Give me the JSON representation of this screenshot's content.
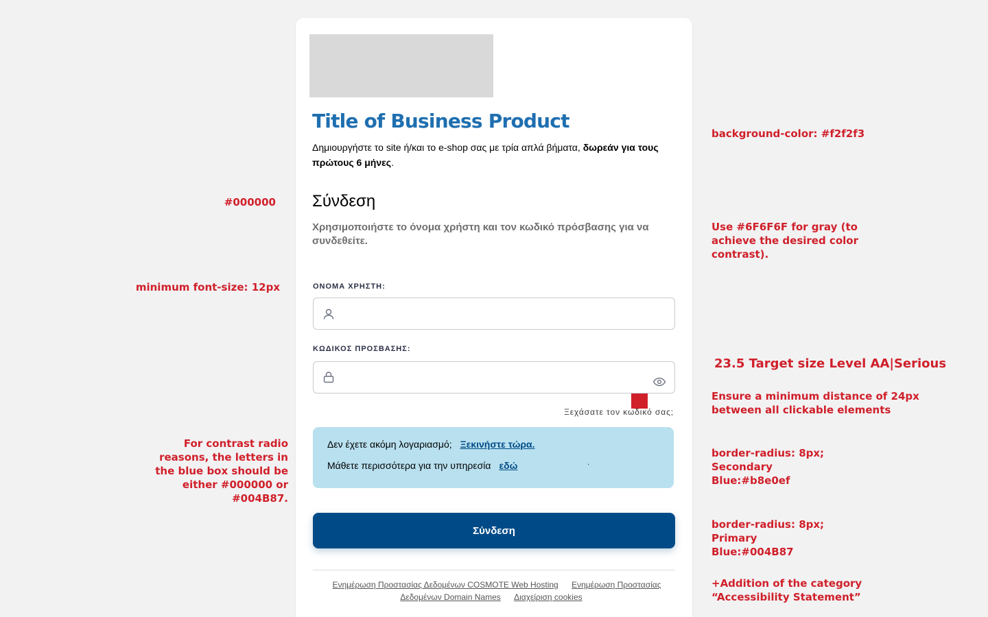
{
  "annotations": {
    "bg_color": "background-color: #f2f2f3",
    "black_color": "#000000",
    "gray_note": "Use #6F6F6F for gray (to achieve the desired color contrast).",
    "min_font": "minimum font-size: 12px",
    "target_size": "23.5 Target size Level AA|Serious",
    "min_distance": "Ensure a minimum distance of 24px between all clickable elements",
    "contrast_note": "For contrast radio reasons, the letters in the blue box should be either #000000 or #004B87.",
    "secondary_blue": "border-radius: 8px; Secondary Blue:#b8e0ef",
    "primary_blue": "border-radius: 8px; Primary Blue:#004B87",
    "accessibility_category": "+Addition of the category “Accessibility Statement”"
  },
  "colors": {
    "primary_blue": "#004B87",
    "secondary_blue": "#b8e0ef",
    "gray_text": "#6F6F6F",
    "background": "#f2f2f3",
    "title_blue": "#1f6fb0",
    "annotation_red": "#d0202a"
  },
  "card": {
    "title": "Title of Business Product",
    "intro_text": "Δημιουργήστε το site ή/και το e-shop σας με τρία απλά βήματα, ",
    "intro_bold": "δωρεάν για τους πρώτους 6 μήνες",
    "intro_end": ".",
    "login_heading": "Σύνδεση",
    "login_description": "Χρησιμοποιήστε το όνομα χρήστη και τον κωδικό πρόσβασης για να συνδεθείτε.",
    "username_label": "ΟΝΟΜΑ ΧΡΗΣΤΗ:",
    "username_icon": "user-icon",
    "password_label": "ΚΩΔΙΚΟΣ ΠΡΟΣΒΑΣΗΣ:",
    "password_icon": "lock-icon",
    "show_password_icon": "eye-icon",
    "forgot_password": "Ξεχάσατε τον κωδικό σας;",
    "info_box": {
      "no_account_text": "Δεν έχετε ακόμη λογαριασμό;",
      "start_link": "Ξεκινήστε τώρα.",
      "learn_more_text": "Μάθετε περισσότερα για την υπηρεσία",
      "here_link": "εδώ",
      "trailing_dot": "."
    },
    "submit_label": "Σύνδεση",
    "footer": {
      "link1": "Ενημέρωση Προστασίας Δεδομένων COSMOTE Web Hosting",
      "link2": "Ενημέρωση Προστασίας Δεδομένων Domain Names",
      "link3": "Διαχείριση cookies"
    }
  }
}
